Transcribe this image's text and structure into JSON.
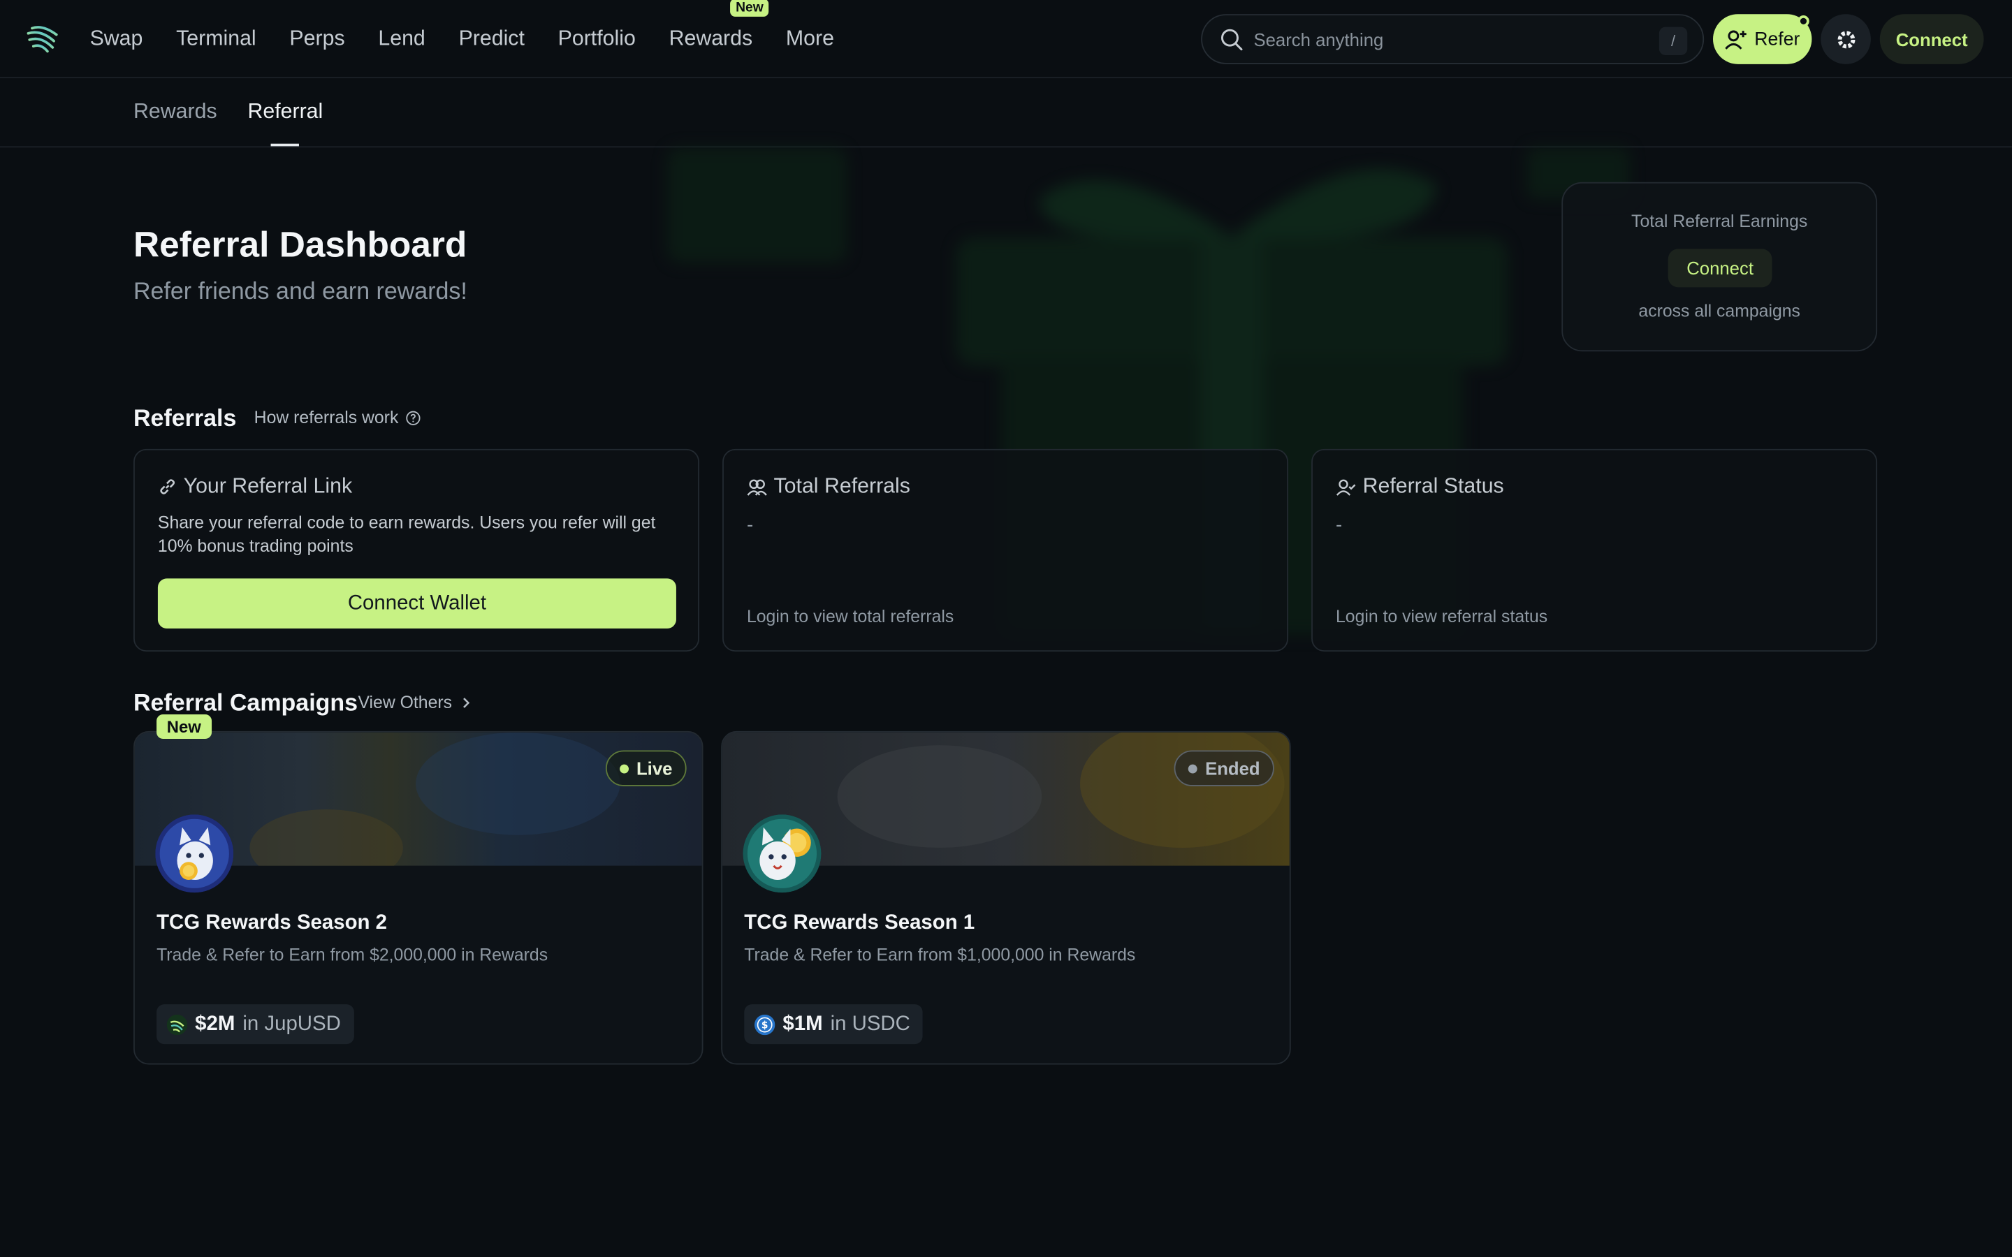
{
  "nav": {
    "items": [
      "Swap",
      "Terminal",
      "Perps",
      "Lend",
      "Predict",
      "Portfolio",
      "Rewards",
      "More"
    ],
    "new_badge": "New"
  },
  "search": {
    "placeholder": "Search anything",
    "shortcut": "/"
  },
  "header_actions": {
    "refer_label": "Refer",
    "connect_label": "Connect"
  },
  "subtabs": [
    "Rewards",
    "Referral"
  ],
  "page": {
    "title": "Referral Dashboard",
    "subtitle": "Refer friends and earn rewards!"
  },
  "earnings": {
    "label": "Total Referral Earnings",
    "connect_label": "Connect",
    "sublabel": "across all campaigns"
  },
  "referrals": {
    "section_title": "Referrals",
    "how_link": "How referrals work",
    "link_card": {
      "title": "Your Referral Link",
      "description": "Share your referral code to earn rewards. Users you refer will get 10% bonus trading points",
      "button": "Connect Wallet"
    },
    "total_card": {
      "title": "Total Referrals",
      "value": "-",
      "hint": "Login to view total referrals"
    },
    "status_card": {
      "title": "Referral Status",
      "value": "-",
      "hint": "Login to view referral status"
    }
  },
  "campaigns": {
    "section_title": "Referral Campaigns",
    "view_others": "View Others",
    "new_tag": "New",
    "items": [
      {
        "status": "Live",
        "name": "TCG Rewards Season 2",
        "description": "Trade & Refer to Earn from $2,000,000 in Rewards",
        "prize_amount": "$2M",
        "prize_unit": "in JupUSD",
        "token_icon": "jupusd-icon"
      },
      {
        "status": "Ended",
        "name": "TCG Rewards Season 1",
        "description": "Trade & Refer to Earn from $1,000,000 in Rewards",
        "prize_amount": "$1M",
        "prize_unit": "in USDC",
        "token_icon": "usdc-icon"
      }
    ]
  },
  "colors": {
    "accent": "#c7f284",
    "background": "#0a0e12"
  }
}
